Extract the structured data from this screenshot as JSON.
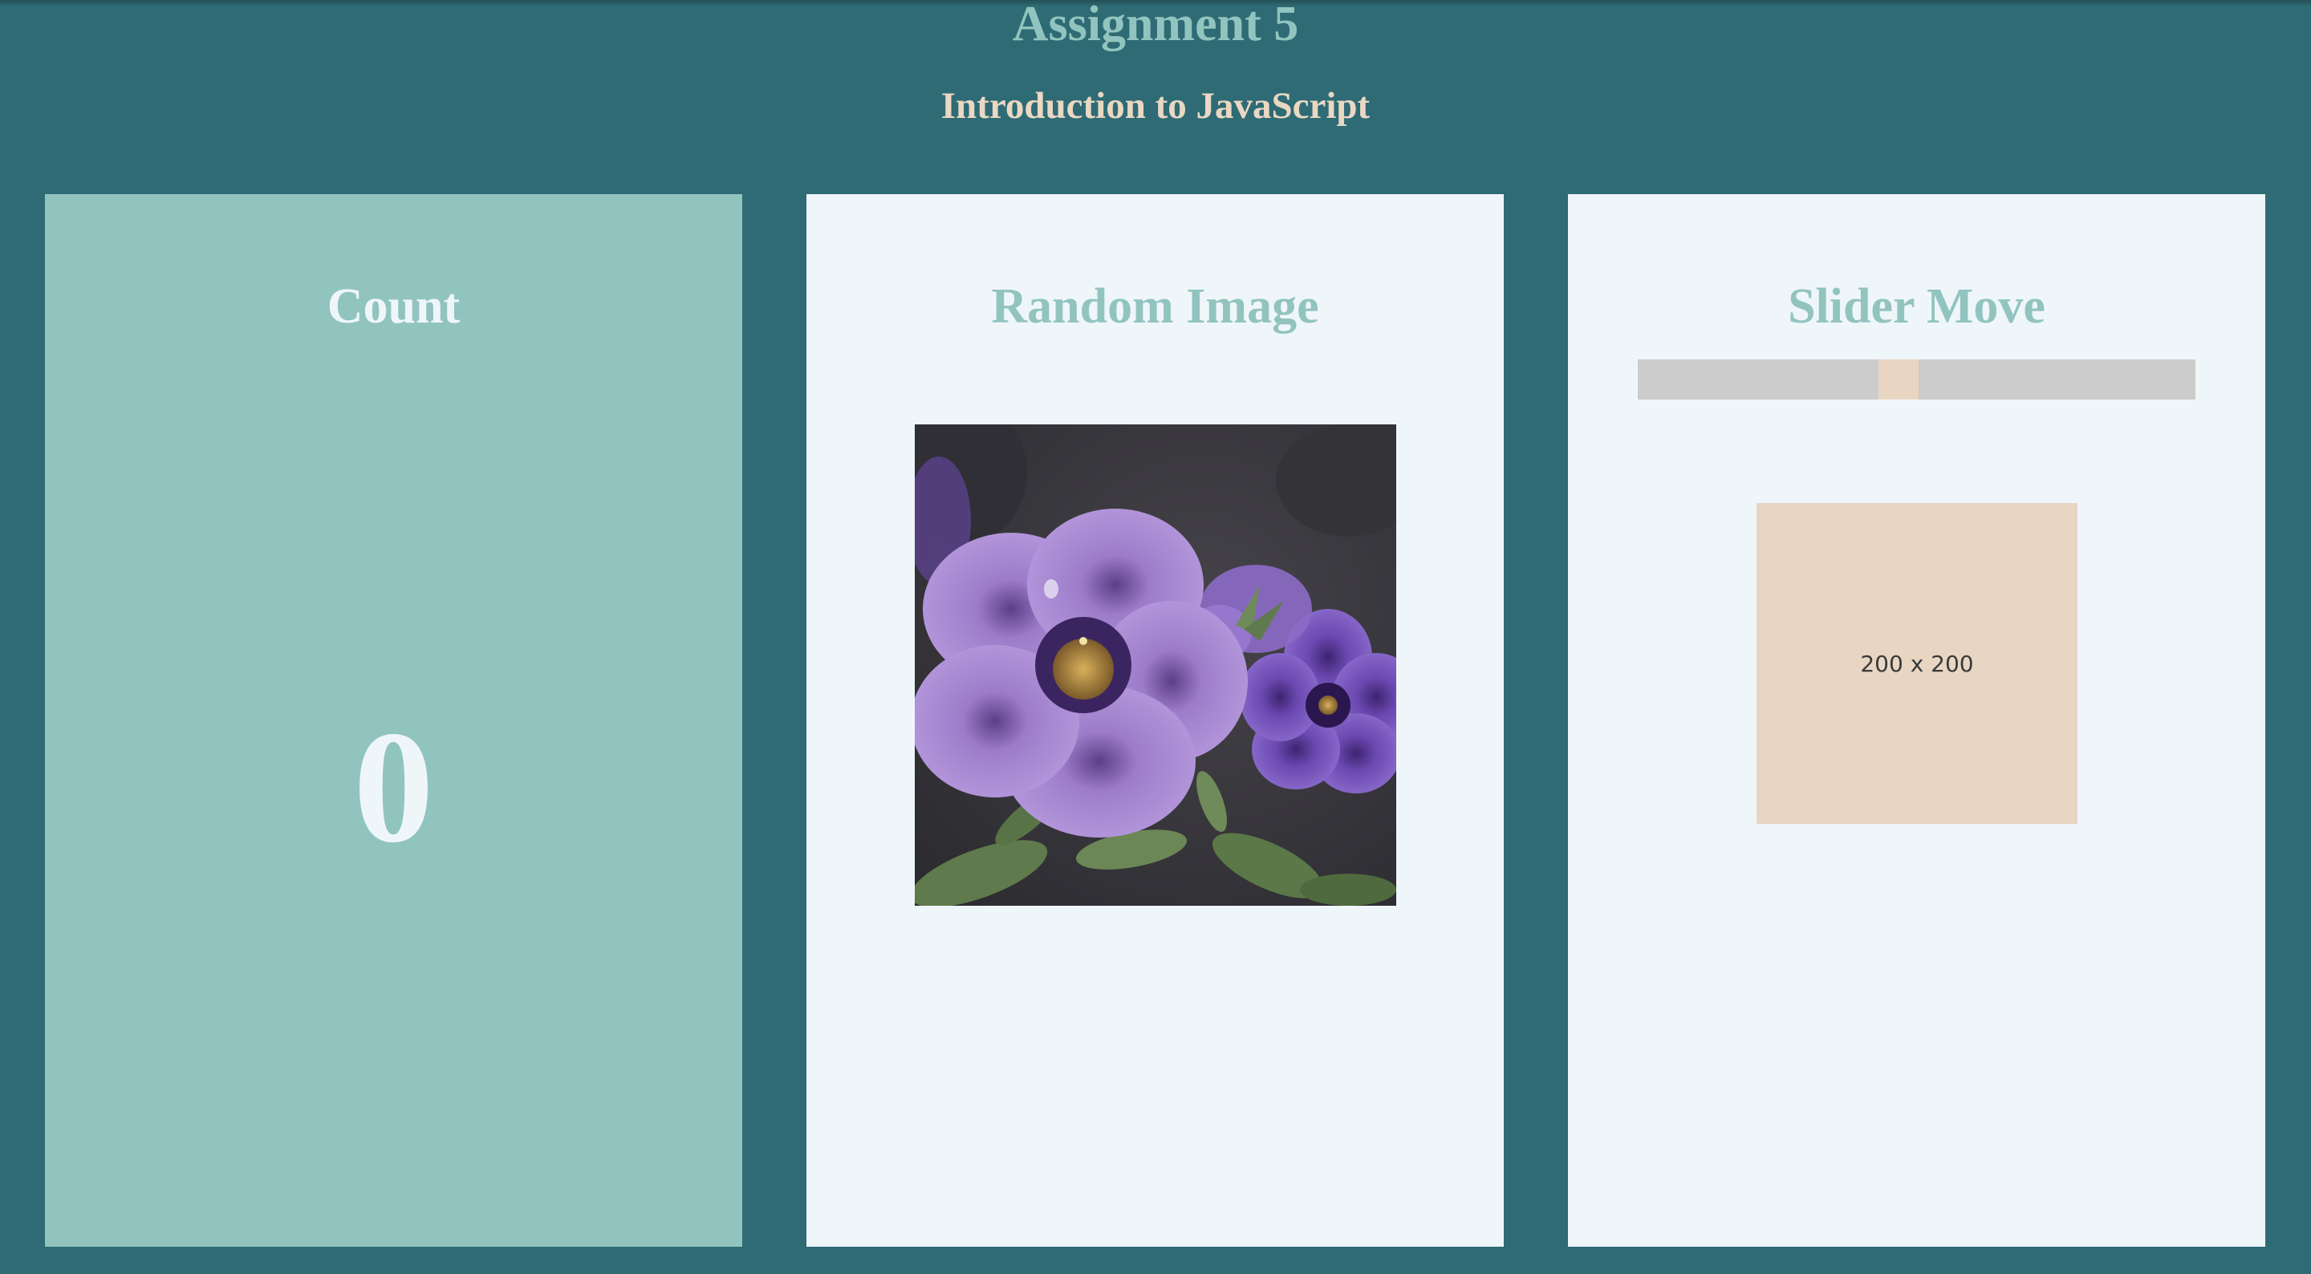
{
  "header": {
    "title": "Assignment 5",
    "subtitle": "Introduction to JavaScript"
  },
  "cards": {
    "count": {
      "heading": "Count",
      "value": "0"
    },
    "random_image": {
      "heading": "Random Image",
      "image_subject": "purple petunia flowers"
    },
    "slider": {
      "heading": "Slider Move",
      "position_fraction": 0.465,
      "placeholder_text": "200 x 200"
    }
  },
  "colors": {
    "page_background": "#2e6b75",
    "teal_light": "#92c4bf",
    "panel_background": "#eff6fa",
    "beige": "#e8d6c3",
    "track_gray": "#cccccc"
  }
}
